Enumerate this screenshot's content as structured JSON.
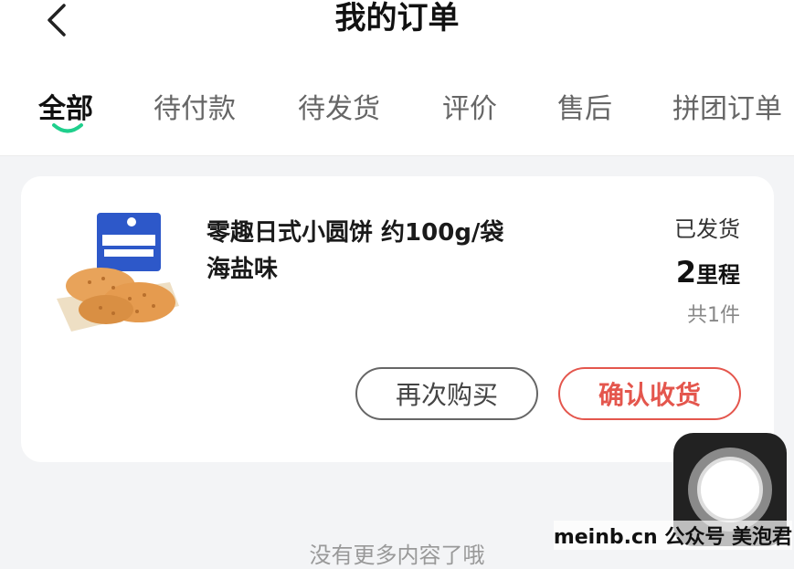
{
  "header": {
    "title": "我的订单"
  },
  "tabs": [
    {
      "label": "全部",
      "active": true
    },
    {
      "label": "待付款",
      "active": false
    },
    {
      "label": "待发货",
      "active": false
    },
    {
      "label": "评价",
      "active": false
    },
    {
      "label": "售后",
      "active": false
    },
    {
      "label": "拼团订单",
      "active": false
    }
  ],
  "order": {
    "product_name": "零趣日式小圆饼 约100g/袋 海盐味",
    "status": "已发货",
    "price_value": "2",
    "price_unit": "里程",
    "quantity": "共1件",
    "buttons": {
      "rebuy": "再次购买",
      "confirm": "确认收货"
    }
  },
  "footer": {
    "no_more": "没有更多内容了哦"
  },
  "watermark": "meinb.cn 公众号 美泡君",
  "colors": {
    "accent_green": "#1fcf8c",
    "confirm_red": "#e4564d",
    "background": "#f3f4f6"
  },
  "icons": {
    "back": "chevron-left-icon",
    "float": "assistive-touch-icon"
  }
}
